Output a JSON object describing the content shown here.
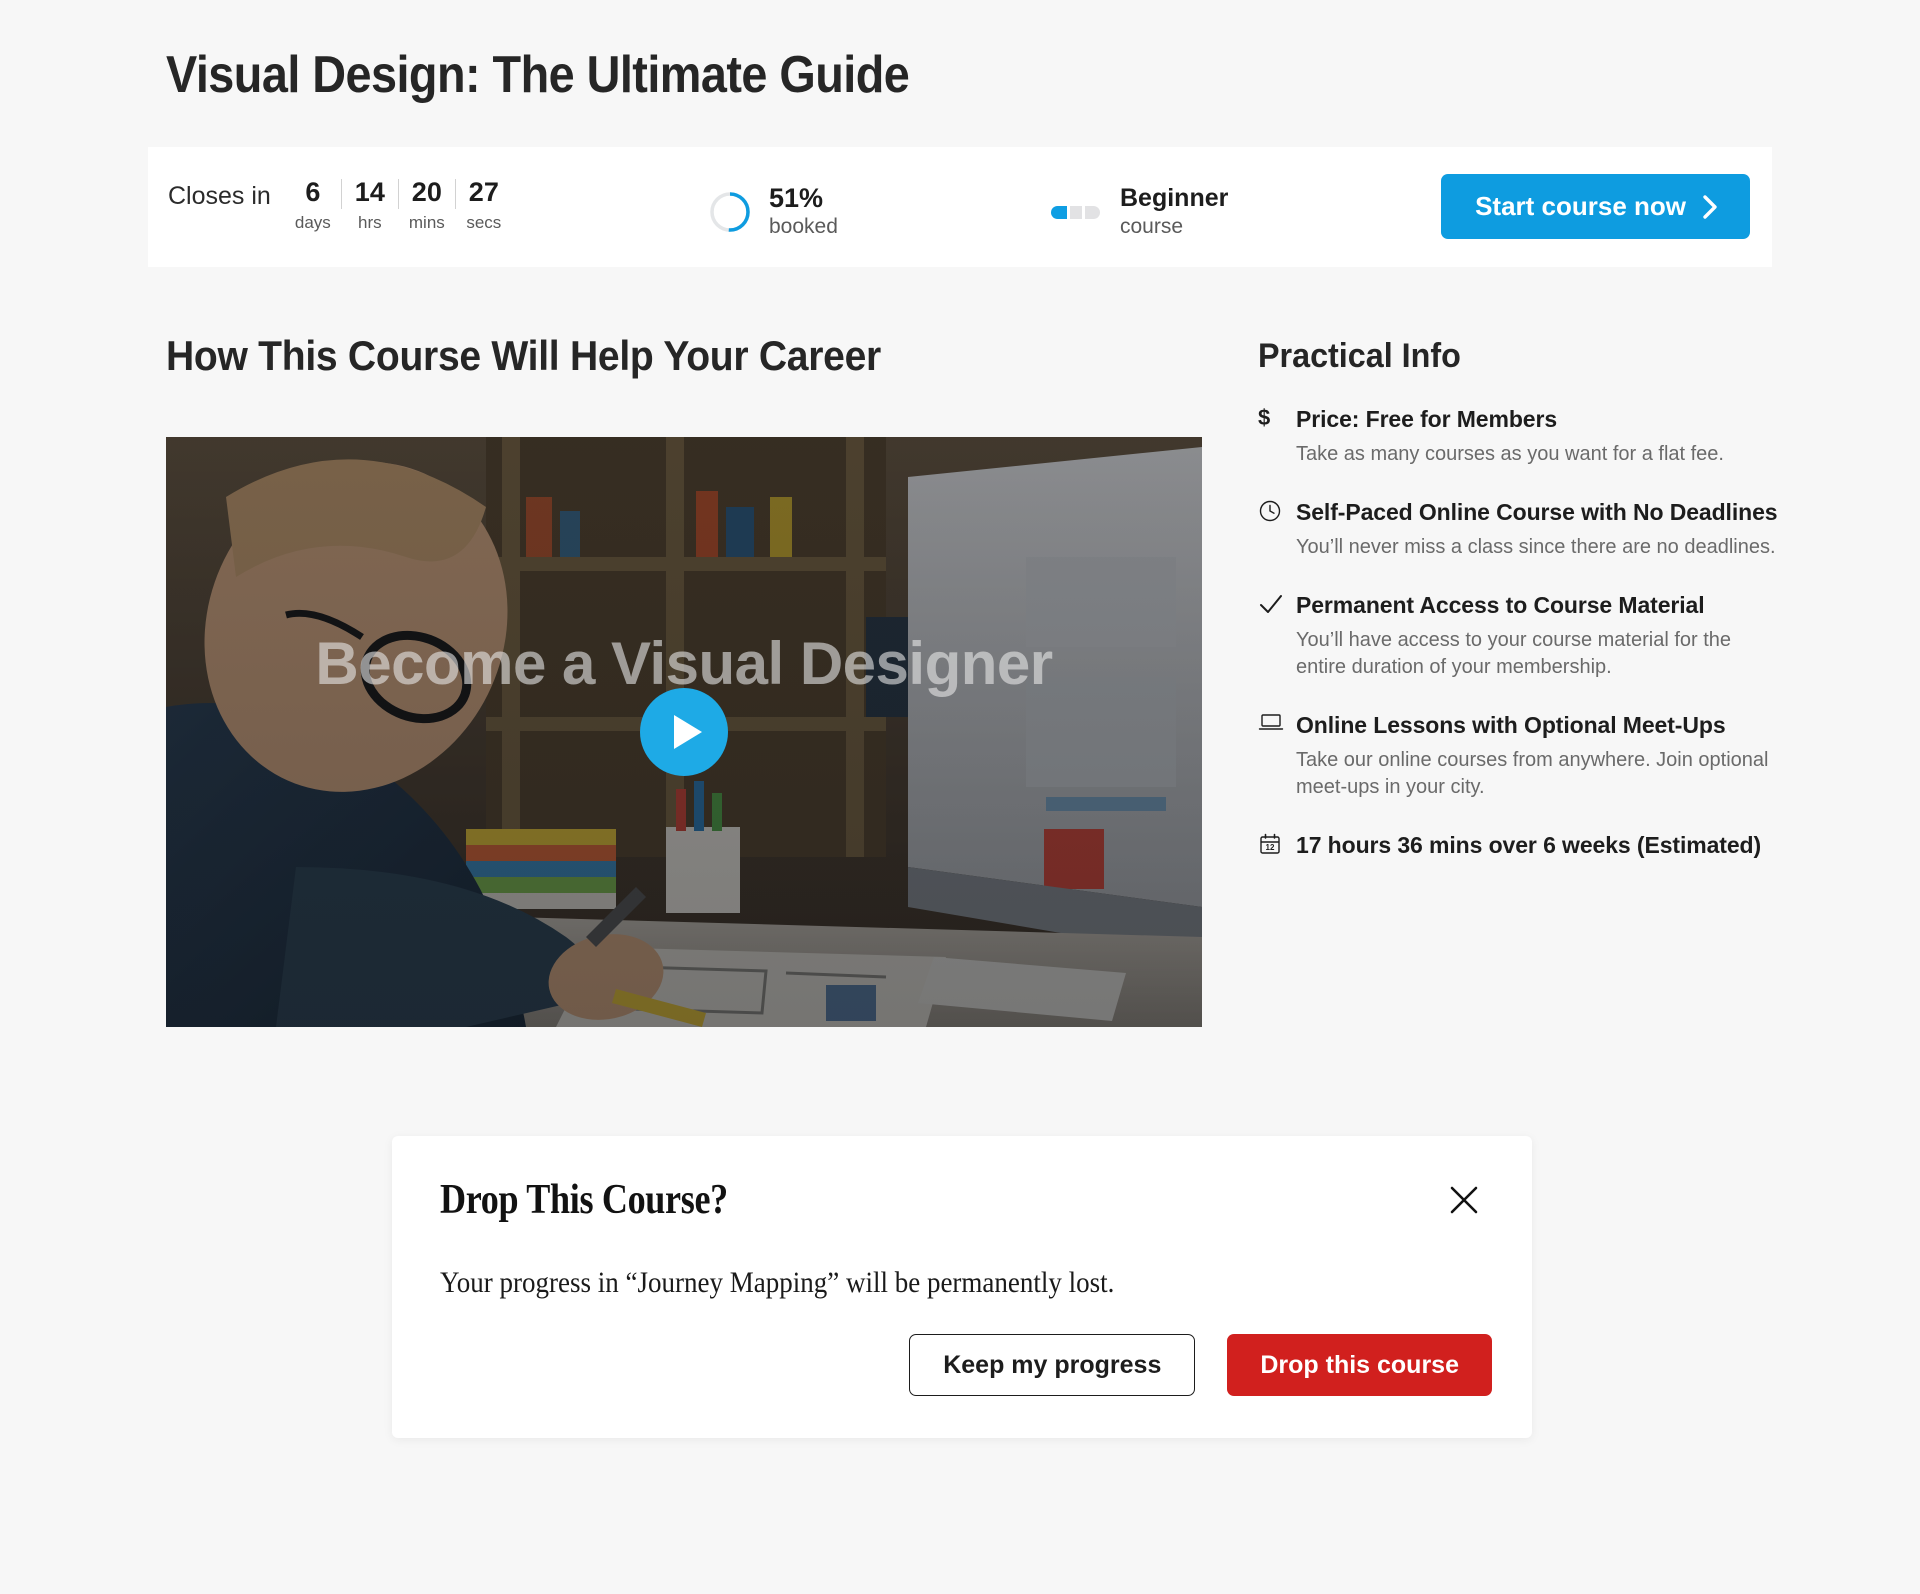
{
  "page": {
    "title": "Visual Design: The Ultimate Guide",
    "background_color": "#f7f7f7",
    "accent_color": "#0e9ce0",
    "danger_color": "#d1201e"
  },
  "status_bar": {
    "countdown": {
      "label": "Closes in",
      "units": [
        {
          "value": "6",
          "label": "days"
        },
        {
          "value": "14",
          "label": "hrs"
        },
        {
          "value": "20",
          "label": "mins"
        },
        {
          "value": "27",
          "label": "secs"
        }
      ]
    },
    "booked": {
      "percent_label": "51%",
      "percent_value": 51,
      "sub_label": "booked",
      "ring_color": "#0e9ce0",
      "track_color": "#e4e6e8"
    },
    "level": {
      "name": "Beginner",
      "sub_label": "course",
      "segments_total": 3,
      "segments_filled": 1,
      "filled_color": "#0f9ee3",
      "empty_color": "#e2e2e4"
    },
    "cta": {
      "label": "Start course now",
      "icon": "chevron-right-icon",
      "color": "#0e9ce0"
    }
  },
  "main": {
    "section_heading": "How This Course Will Help Your Career",
    "video": {
      "caption": "Become a Visual Designer",
      "play_icon": "play-icon",
      "play_color": "#1eaae6"
    }
  },
  "practical_info": {
    "title": "Practical Info",
    "items": [
      {
        "icon": "dollar-icon",
        "title": "Price: Free for Members",
        "desc": "Take as many courses as you want for a flat fee."
      },
      {
        "icon": "clock-icon",
        "title": "Self-Paced Online Course with No Deadlines",
        "desc": "You’ll never miss a class since there are no deadlines."
      },
      {
        "icon": "check-icon",
        "title": "Permanent Access to Course Material",
        "desc": "You’ll have access to your course material for the entire duration of your membership."
      },
      {
        "icon": "laptop-icon",
        "title": "Online Lessons with Optional Meet-Ups",
        "desc": "Take our online courses from anywhere. Join optional meet-ups in your city."
      },
      {
        "icon": "calendar-icon",
        "title": "17 hours 36 mins over 6 weeks (Estimated)",
        "desc": "",
        "calendar_day": "12"
      }
    ]
  },
  "modal": {
    "title": "Drop This Course?",
    "body": "Your progress in “Journey Mapping” will be permanently lost.",
    "close_icon": "close-icon",
    "keep_label": "Keep my progress",
    "drop_label": "Drop this course"
  }
}
